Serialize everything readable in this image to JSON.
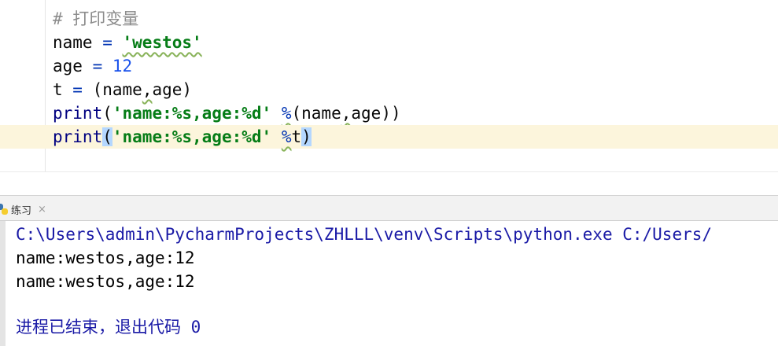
{
  "editor": {
    "lines": [
      {
        "parts": [
          "# 打印变量"
        ]
      },
      {
        "parts": [
          "name",
          " = ",
          "'westos'"
        ]
      },
      {
        "parts": [
          "age",
          " = ",
          "12"
        ]
      },
      {
        "parts": [
          "t",
          " = ",
          "(",
          "name",
          ",",
          "age",
          ")"
        ]
      },
      {
        "parts": [
          "print",
          "(",
          "'name:%s,age:%d'",
          " ",
          "%",
          "(",
          "name",
          ",",
          "age",
          "))"
        ]
      },
      {
        "parts": [
          "print",
          "(",
          "'name:%s,age:%d'",
          " ",
          "%",
          "t",
          ")"
        ]
      }
    ]
  },
  "run_panel": {
    "tab_label": "练习",
    "close_symbol": "×",
    "icon": "python-icon"
  },
  "console": {
    "command": "C:\\Users\\admin\\PycharmProjects\\ZHLLL\\venv\\Scripts\\python.exe C:/Users/",
    "output": [
      "name:westos,age:12",
      "name:westos,age:12"
    ],
    "exit_message": "进程已结束，退出代码 0"
  },
  "colors": {
    "current_line": "#fcf5dc",
    "string": "#067d17",
    "number": "#1750eb",
    "keyword_builtin": "#000080",
    "brace_highlight": "#b4d7ff"
  }
}
